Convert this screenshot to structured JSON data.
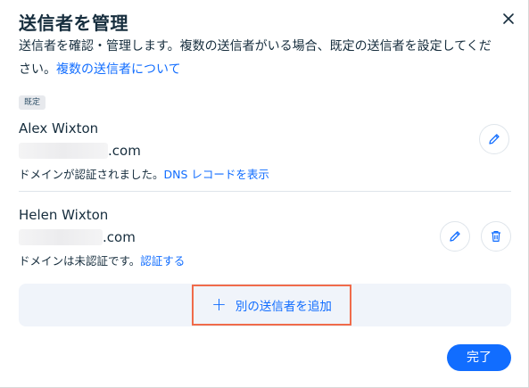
{
  "dialog": {
    "title": "送信者を管理",
    "subtitle_text": "送信者を確認・管理します。複数の送信者がいる場合、既定の送信者を設定してください。",
    "subtitle_link": "複数の送信者について",
    "close_icon": "close-icon"
  },
  "default_badge": "既定",
  "senders": [
    {
      "name": "Alex Wixton",
      "email_domain": ".com",
      "status_text": "ドメインが認証されました。",
      "status_link": "DNS レコードを表示",
      "actions": [
        "edit-icon"
      ]
    },
    {
      "name": "Helen Wixton",
      "email_domain": ".com",
      "status_text": "ドメインは未認証です。",
      "status_link": "認証する",
      "actions": [
        "edit-icon",
        "delete-icon"
      ]
    }
  ],
  "add_sender": {
    "label": "別の送信者を追加",
    "icon": "plus-icon",
    "highlight_color": "#f06b4a"
  },
  "done_button": "完了",
  "colors": {
    "accent": "#116dff",
    "text": "#162d3d",
    "add_area_bg": "#f0f4fa"
  }
}
